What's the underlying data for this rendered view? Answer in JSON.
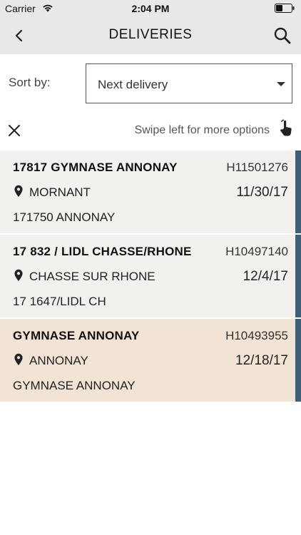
{
  "status": {
    "carrier": "Carrier",
    "time": "2:04 PM"
  },
  "nav": {
    "title": "DELIVERIES"
  },
  "sort": {
    "label": "Sort by:",
    "value": "Next delivery"
  },
  "hint": {
    "text": "Swipe left for more options"
  },
  "deliveries": [
    {
      "title": "17817 GYMNASE ANNONAY",
      "code": "H11501276",
      "city": "MORNANT",
      "date": "11/30/17",
      "sub": "171750 ANNONAY"
    },
    {
      "title": "17 832 / LIDL CHASSE/RHONE",
      "code": "H10497140",
      "city": "CHASSE SUR RHONE",
      "date": "12/4/17",
      "sub": "17 1647/LIDL CH"
    },
    {
      "title": "GYMNASE ANNONAY",
      "code": "H10493955",
      "city": "ANNONAY",
      "date": "12/18/17",
      "sub": "GYMNASE ANNONAY"
    }
  ],
  "colors": {
    "accent_bar": "#3e5f77",
    "card_bg": "#f2f1ee",
    "card_highlight_bg": "#f1e4d4",
    "header_bg": "#e8e8e8"
  },
  "icons": {
    "back": "chevron-left-icon",
    "search": "search-icon",
    "close": "close-icon",
    "swipe": "swipe-hand-icon",
    "pin": "location-pin-icon",
    "dropdown": "caret-down-icon"
  }
}
